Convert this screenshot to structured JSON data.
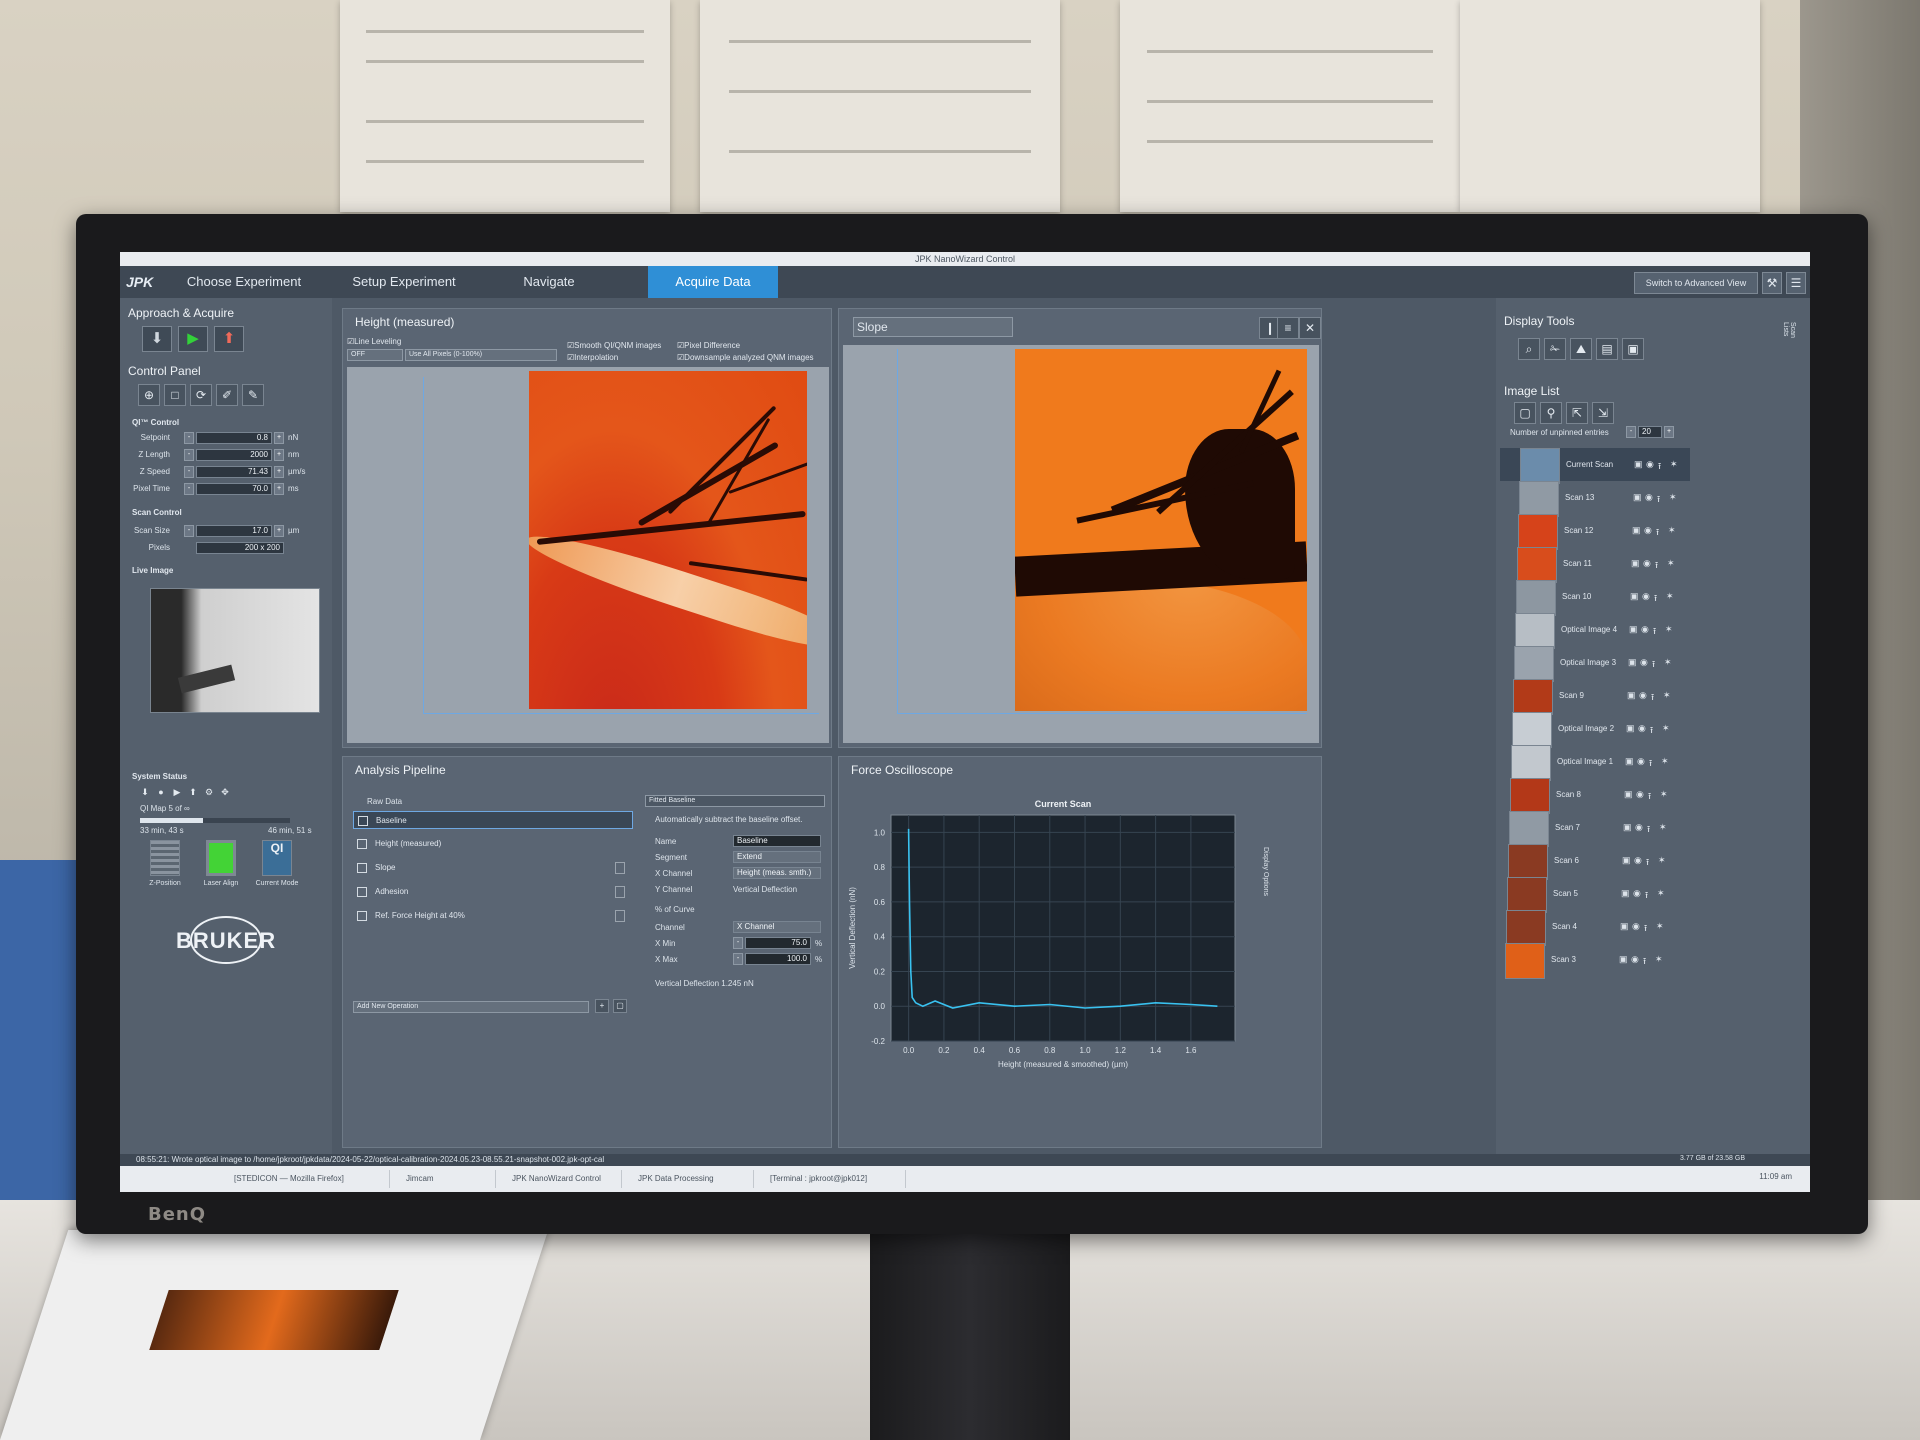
{
  "window": {
    "title": "JPK NanoWizard Control"
  },
  "logo": "JPK",
  "tabs": [
    "Choose Experiment",
    "Setup Experiment",
    "Navigate",
    "Acquire Data"
  ],
  "advanced_view": "Switch to Advanced View",
  "left_panel": {
    "approach_title": "Approach & Acquire",
    "control_title": "Control Panel",
    "qi_title": "QI™ Control",
    "params": [
      {
        "label": "Setpoint",
        "value": "0.8",
        "unit": "nN"
      },
      {
        "label": "Z Length",
        "value": "2000",
        "unit": "nm"
      },
      {
        "label": "Z Speed",
        "value": "71.43",
        "unit": "µm/s"
      },
      {
        "label": "Pixel Time",
        "value": "70.0",
        "unit": "ms"
      }
    ],
    "scan_title": "Scan Control",
    "scan_size": {
      "label": "Scan Size",
      "value": "17.0",
      "unit": "µm"
    },
    "pixels": {
      "label": "Pixels",
      "value": "200 x 200"
    },
    "live_title": "Live Image",
    "system_title": "System Status",
    "qi_map": "QI Map 5 of ∞",
    "elapsed": "33 min, 43 s",
    "remaining": "46 min, 51 s",
    "progress_fraction": 0.42,
    "status_captions": [
      "Z-Position",
      "Laser Align",
      "Current Mode"
    ],
    "brand": "BRUKER"
  },
  "height_panel": {
    "title": "Height (measured)",
    "line_leveling_label": "Line Leveling",
    "leveling_value": "OFF",
    "leveling_pixels": "Use All Pixels (0-100%)",
    "checks": [
      "Smooth QI/QNM images",
      "Pixel Difference",
      "Interpolation",
      "Downsample analyzed QNM images"
    ]
  },
  "slope_panel": {
    "title": "Slope"
  },
  "pipeline": {
    "title": "Analysis Pipeline",
    "raw_label": "Raw Data",
    "items": [
      "Baseline",
      "Height (measured)",
      "Slope",
      "Adhesion",
      "Ref. Force Height at 40%"
    ],
    "add_placeholder": "Add New Operation",
    "op_title": "Fitted Baseline",
    "op_desc": "Automatically subtract the baseline offset.",
    "fields": [
      {
        "label": "Name",
        "value": "Baseline"
      },
      {
        "label": "Segment",
        "value": "Extend"
      },
      {
        "label": "X Channel",
        "value": "Height (meas. smth.)"
      },
      {
        "label": "Y Channel",
        "value": "Vertical Deflection"
      }
    ],
    "curve_label": "% of Curve",
    "channel_label": "Channel",
    "channel_value": "X Channel",
    "xmin_label": "X Min",
    "xmin_value": "75.0",
    "xmax_label": "X Max",
    "xmax_value": "100.0",
    "pct": "%",
    "deflection": "Vertical Deflection  1.245 nN"
  },
  "oscilloscope": {
    "title": "Force Oscilloscope",
    "display_options": "Display Options"
  },
  "chart_data": {
    "type": "line",
    "title": "Current Scan",
    "xlabel": "Height (measured & smoothed) (µm)",
    "ylabel": "Vertical Deflection (nN)",
    "xlim": [
      -0.1,
      1.85
    ],
    "ylim": [
      -0.2,
      1.1
    ],
    "xticks": [
      "0.0",
      "0.2",
      "0.4",
      "0.6",
      "0.8",
      "1.0",
      "1.2",
      "1.4",
      "1.6"
    ],
    "yticks": [
      "1.0",
      "0.8",
      "0.6",
      "0.4",
      "0.2",
      "0.0",
      "-0.2"
    ],
    "grid": true,
    "series": [
      {
        "x": [
          0.0,
          0.005,
          0.012,
          0.02,
          0.04,
          0.08,
          0.15,
          0.25,
          0.4,
          0.6,
          0.8,
          1.0,
          1.2,
          1.4,
          1.6,
          1.75
        ],
        "y": [
          1.02,
          0.6,
          0.2,
          0.05,
          0.02,
          0.0,
          0.03,
          -0.01,
          0.02,
          0.0,
          0.01,
          -0.01,
          0.0,
          0.02,
          0.01,
          0.0
        ]
      }
    ]
  },
  "right_panel": {
    "display_tools_title": "Display Tools",
    "image_list_title": "Image List",
    "unpinned_label": "Number of unpinned entries",
    "unpinned_value": "20",
    "side_tab": "Scan Lists",
    "entries": [
      "Current Scan",
      "Scan 13",
      "Scan 12",
      "Scan 11",
      "Scan 10",
      "Optical Image 4",
      "Optical Image 3",
      "Scan 9",
      "Optical Image 2",
      "Optical Image 1",
      "Scan 8",
      "Scan 7",
      "Scan 6",
      "Scan 5",
      "Scan 4",
      "Scan 3"
    ],
    "memory": "3.77 GB of 23.58 GB"
  },
  "statusline": "08:55:21: Wrote optical image to /home/jpkroot/jpkdata/2024-05-22/optical-calibration-2024.05.23-08.55.21-snapshot-002.jpk-opt-cal",
  "taskbar": [
    "[STEDICON — Mozilla Firefox]",
    "Jimcam",
    "JPK NanoWizard Control",
    "JPK Data Processing",
    "[Terminal : jpkroot@jpk012]"
  ],
  "clock": "11:09 am",
  "monitor_brand": "BenQ",
  "colors": {
    "accent": "#2f8fd6",
    "panel": "#5a6573",
    "plot_trace": "#39c2f0"
  }
}
